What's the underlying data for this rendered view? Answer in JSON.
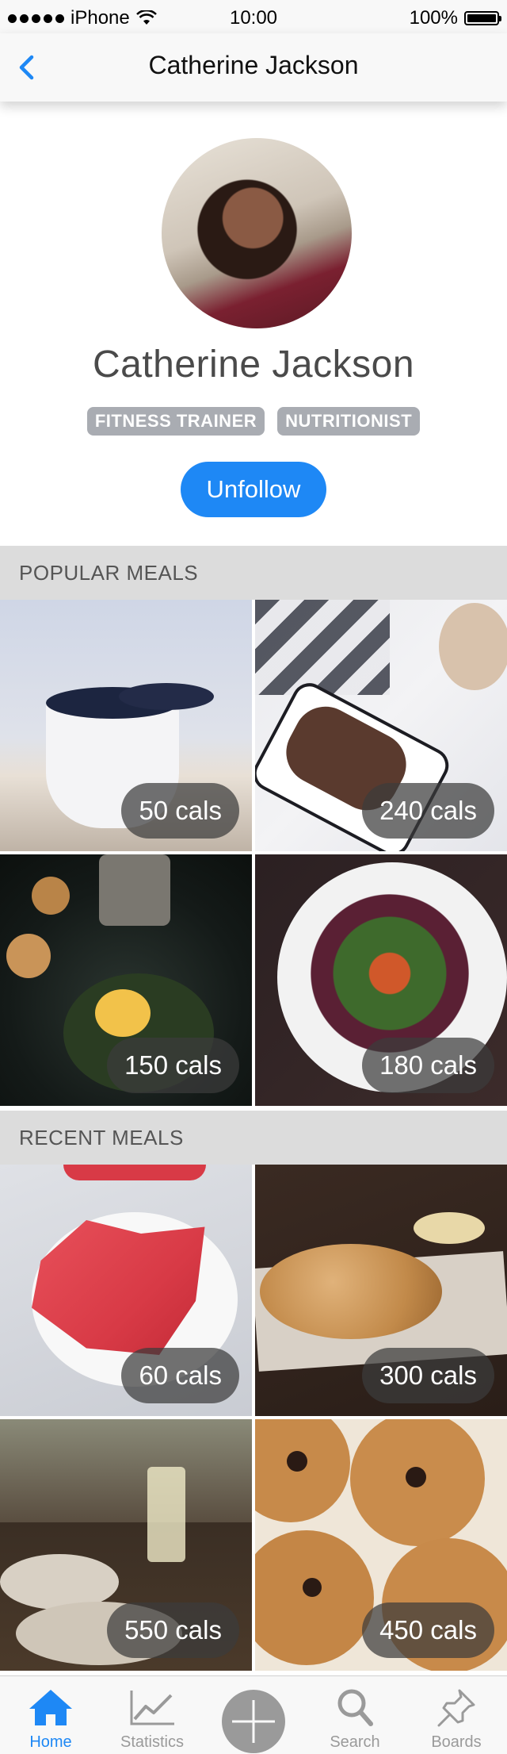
{
  "status_bar": {
    "carrier": "iPhone",
    "time": "10:00",
    "battery": "100%"
  },
  "nav": {
    "title": "Catherine Jackson"
  },
  "profile": {
    "name": "Catherine Jackson",
    "tags": [
      "FITNESS TRAINER",
      "NUTRITIONIST"
    ],
    "unfollow_label": "Unfollow"
  },
  "sections": {
    "popular": {
      "title": "POPULAR MEALS",
      "meals": [
        {
          "calories": "50 cals",
          "image": "blueberries"
        },
        {
          "calories": "240 cals",
          "image": "granola"
        },
        {
          "calories": "150 cals",
          "image": "toast"
        },
        {
          "calories": "180 cals",
          "image": "salad"
        }
      ]
    },
    "recent": {
      "title": "RECENT MEALS",
      "meals": [
        {
          "calories": "60 cals",
          "image": "watermelon"
        },
        {
          "calories": "300 cals",
          "image": "bread"
        },
        {
          "calories": "550 cals",
          "image": "dinner"
        },
        {
          "calories": "450 cals",
          "image": "cookies"
        }
      ]
    }
  },
  "tab_bar": {
    "home": "Home",
    "statistics": "Statistics",
    "search": "Search",
    "boards": "Boards"
  },
  "colors": {
    "accent": "#1e88f5",
    "tag_bg": "#a9acb2",
    "section_bg": "#dcdcdc"
  }
}
